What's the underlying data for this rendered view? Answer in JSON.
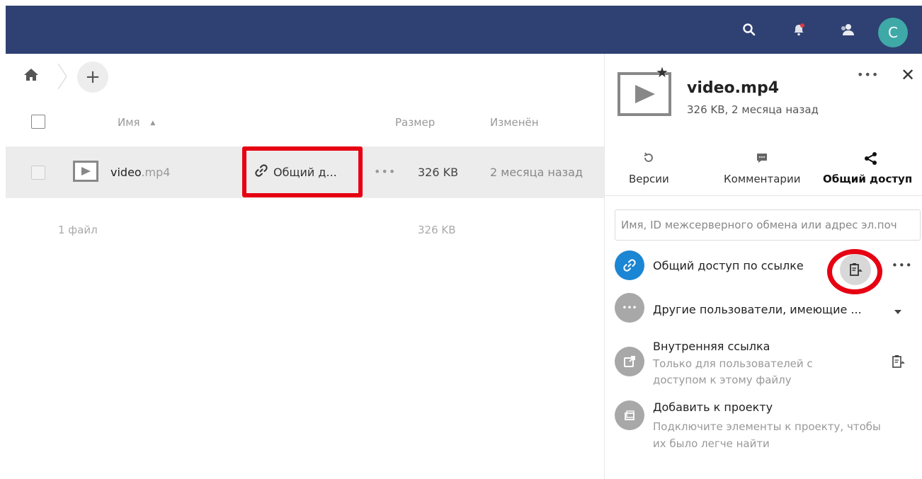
{
  "header": {
    "avatar_letter": "C"
  },
  "files": {
    "columns": {
      "name": "Имя",
      "sort_indicator": "▲",
      "size": "Размер",
      "modified": "Изменён"
    },
    "rows": [
      {
        "name": "video",
        "ext": ".mp4",
        "share_label": "Общий д...",
        "more": "•••",
        "size": "326 KB",
        "modified": "2 месяца назад"
      }
    ],
    "summary": {
      "count": "1 файл",
      "size": "326 KB"
    },
    "add_label": "+"
  },
  "sidebar": {
    "title": "video.mp4",
    "subtitle": "326 KB, 2 месяца назад",
    "more": "•••",
    "close": "✕",
    "tabs": [
      {
        "label": "Версии"
      },
      {
        "label": "Комментарии"
      },
      {
        "label": "Общий доступ"
      }
    ],
    "share_search_placeholder": "Имя, ID межсерверного обмена или адрес эл.поч",
    "link_share": {
      "label": "Общий доступ по ссылке",
      "more": "•••"
    },
    "others": {
      "label": "Другие пользователи, имеющие ...",
      "more": "•••"
    },
    "internal_link": {
      "label": "Внутренняя ссылка",
      "sub1": "Только для пользователей с",
      "sub2": "доступом к этому файлу"
    },
    "project": {
      "label": "Добавить к проекту",
      "sub1": "Подключите элементы к проекту, чтобы",
      "sub2": "их было легче найти"
    }
  },
  "colors": {
    "header_bg": "#2f4072",
    "avatar_bg": "#3fa9a8",
    "highlight_red": "#e60012",
    "link_blue": "#1b86d3"
  }
}
